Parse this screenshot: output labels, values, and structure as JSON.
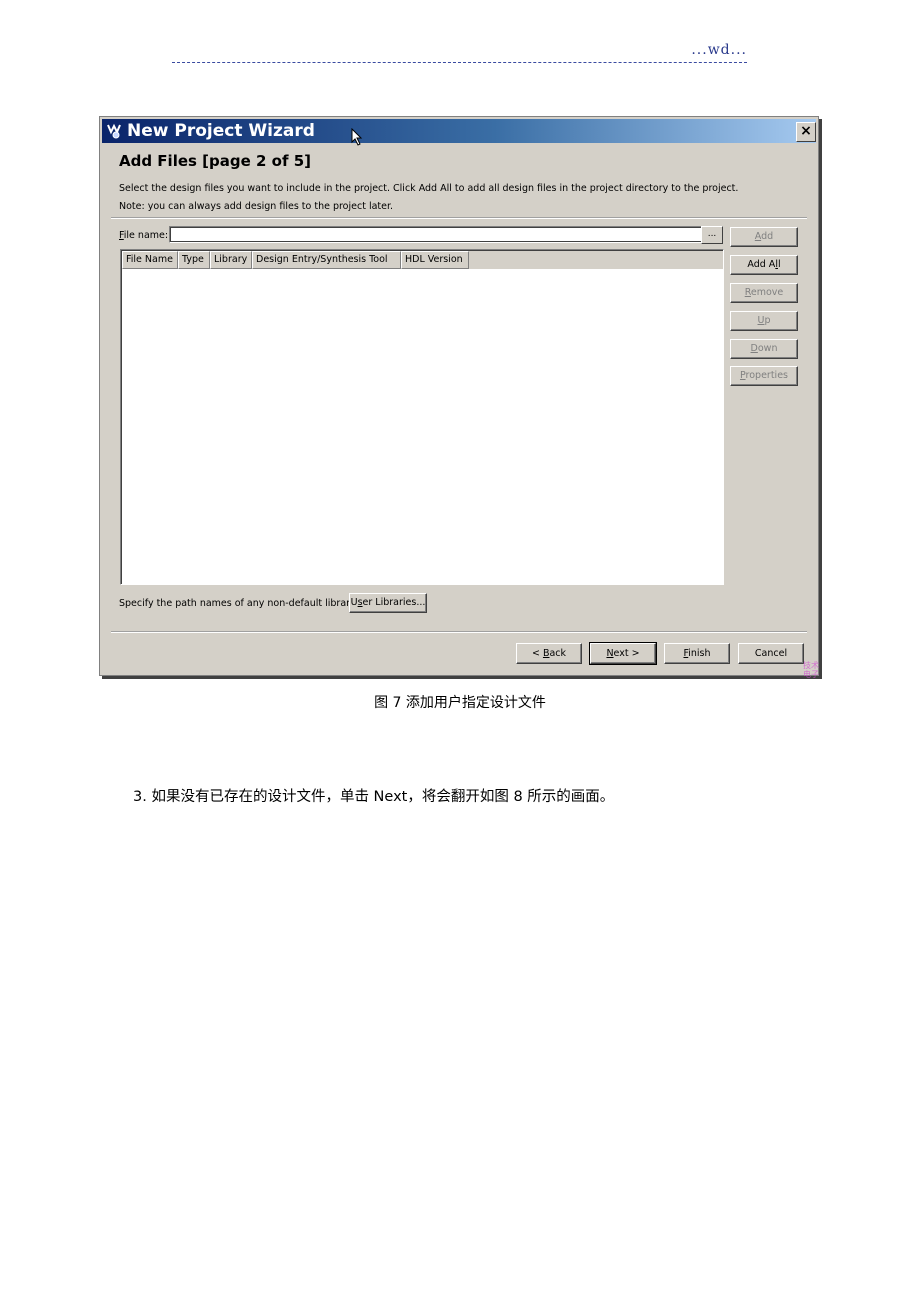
{
  "page_header": {
    "mark": "...wd..."
  },
  "dialog": {
    "title": "New Project Wizard",
    "close_label": "×",
    "page_heading": "Add Files [page 2 of 5]",
    "description_line1": "Select the design files you want to include in the project. Click Add All to add all design files in the project directory to the project.",
    "description_line2": "Note: you can always add design files to the project later.",
    "file_name": {
      "label_mnemonic": "F",
      "label_rest": "ile name:",
      "value": "",
      "placeholder": "",
      "browse_label": "..."
    },
    "file_table": {
      "columns": [
        "File Name",
        "Type",
        "Library",
        "Design Entry/Synthesis Tool",
        "HDL Version"
      ],
      "rows": []
    },
    "side_buttons": [
      {
        "pre": "",
        "mnemonic": "A",
        "post": "dd",
        "enabled": false
      },
      {
        "pre": "Add A",
        "mnemonic": "l",
        "post": "l",
        "enabled": true
      },
      {
        "pre": "",
        "mnemonic": "R",
        "post": "emove",
        "enabled": false
      },
      {
        "pre": "",
        "mnemonic": "U",
        "post": "p",
        "enabled": false
      },
      {
        "pre": "",
        "mnemonic": "D",
        "post": "own",
        "enabled": false
      },
      {
        "pre": "",
        "mnemonic": "P",
        "post": "roperties",
        "enabled": false
      }
    ],
    "libraries": {
      "label": "Specify the path names of any non-default libraries.",
      "button_pre": "U",
      "button_mnemonic": "s",
      "button_post": "er Libraries..."
    },
    "nav_buttons": {
      "back": {
        "pre": "< ",
        "mnemonic": "B",
        "post": "ack"
      },
      "next": {
        "pre": "",
        "mnemonic": "N",
        "post": "ext >"
      },
      "finish": {
        "pre": "",
        "mnemonic": "F",
        "post": "inish"
      },
      "cancel": {
        "label": "Cancel"
      }
    },
    "watermark": "技术\n电子"
  },
  "caption": "图 7  添加用户指定设计文件",
  "paragraph": "3.  如果没有已存在的设计文件，单击 Next，将会翻开如图 8 所示的画面。"
}
